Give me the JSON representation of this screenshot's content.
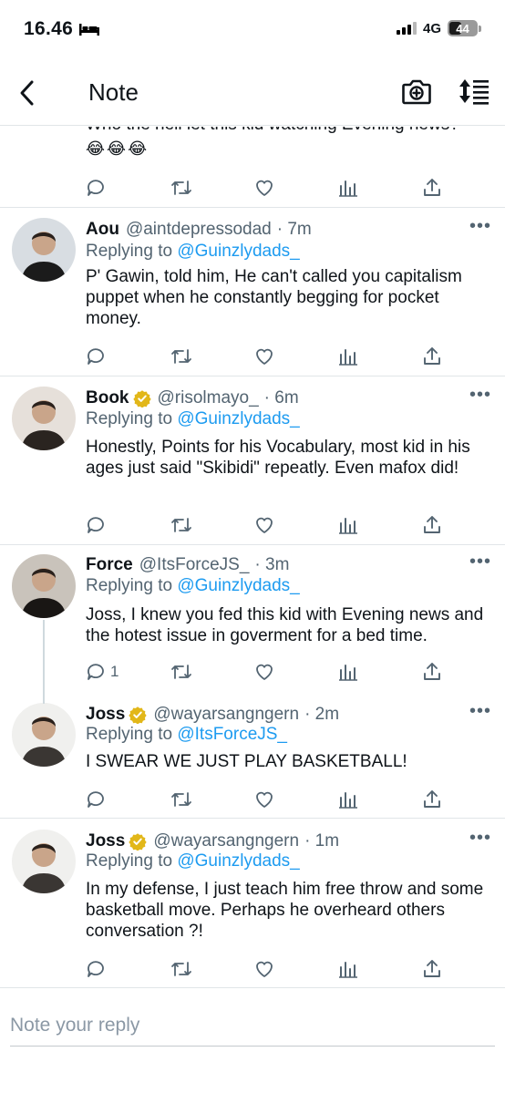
{
  "status_bar": {
    "time": "16.46",
    "network": "4G",
    "battery_level": "44",
    "battery_fraction": 0.44
  },
  "nav": {
    "title": "Note"
  },
  "partial_tweet": {
    "text": "Who the hell let this kid watching Evening news?",
    "emojis": "😂😂😂"
  },
  "tweets": [
    {
      "name": "Aou",
      "handle": "@aintdepressodad",
      "time": "· 7m",
      "verified": false,
      "replying_prefix": "Replying to ",
      "replying_to": "@Guinzlydads_",
      "text": "P' Gawin, told him, He can't called you capitalism puppet when he constantly begging for pocket money.",
      "reply_count": ""
    },
    {
      "name": "Book",
      "handle": "@risolmayo_",
      "time": "· 6m",
      "verified": true,
      "replying_prefix": "Replying to ",
      "replying_to": "@Guinzlydads_",
      "text": "Honestly, Points for his Vocabulary, most kid in his ages just said \"Skibidi\" repeatly. Even mafox did!",
      "reply_count": ""
    },
    {
      "name": "Force",
      "handle": "@ItsForceJS_",
      "time": "· 3m",
      "verified": false,
      "replying_prefix": "Replying to ",
      "replying_to": "@Guinzlydads_",
      "text": "Joss, I knew you fed this kid with Evening news and the hotest issue in goverment for a bed time.",
      "reply_count": "1"
    },
    {
      "name": "Joss",
      "handle": "@wayarsangngern",
      "time": "· 2m",
      "verified": true,
      "replying_prefix": "Replying to ",
      "replying_to": "@ItsForceJS_",
      "text": "I SWEAR WE JUST PLAY BASKETBALL!",
      "reply_count": ""
    },
    {
      "name": "Joss",
      "handle": "@wayarsangngern",
      "time": "· 1m",
      "verified": true,
      "replying_prefix": "Replying to ",
      "replying_to": "@Guinzlydads_",
      "text": "In my defense, I just teach him free throw and some basketball move. Perhaps he overheard others conversation ?!",
      "reply_count": ""
    }
  ],
  "reply_box": {
    "placeholder": "Note your reply"
  },
  "colors": {
    "link": "#1d9bf0",
    "secondary_text": "#536471",
    "verified_badge": "#e2b719",
    "divider": "#e1e5e8"
  },
  "icons": [
    "back-chevron-icon",
    "camera-plus-icon",
    "sort-icon",
    "reply-icon",
    "retweet-icon",
    "like-icon",
    "views-icon",
    "share-icon",
    "verified-badge-icon",
    "more-icon"
  ]
}
